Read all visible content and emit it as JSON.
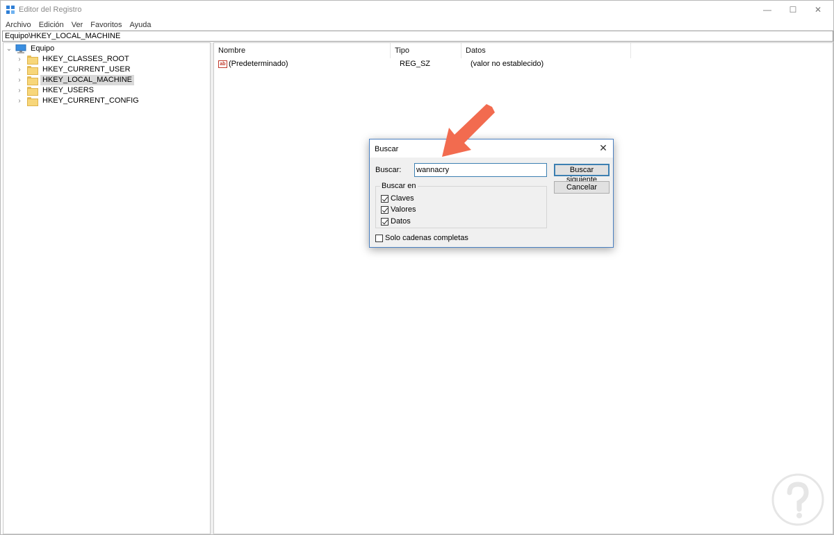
{
  "window": {
    "title": "Editor del Registro",
    "controls": {
      "minimize": "—",
      "maximize": "☐",
      "close": "✕"
    }
  },
  "menu": [
    "Archivo",
    "Edición",
    "Ver",
    "Favoritos",
    "Ayuda"
  ],
  "address": "Equipo\\HKEY_LOCAL_MACHINE",
  "tree": {
    "root": "Equipo",
    "items": [
      {
        "label": "HKEY_CLASSES_ROOT"
      },
      {
        "label": "HKEY_CURRENT_USER"
      },
      {
        "label": "HKEY_LOCAL_MACHINE"
      },
      {
        "label": "HKEY_USERS"
      },
      {
        "label": "HKEY_CURRENT_CONFIG"
      }
    ]
  },
  "list": {
    "columns": [
      "Nombre",
      "Tipo",
      "Datos"
    ],
    "rows": [
      {
        "name": "(Predeterminado)",
        "type": "REG_SZ",
        "data": "(valor no establecido)",
        "icon": "ab"
      }
    ]
  },
  "dialog": {
    "title": "Buscar",
    "find_label": "Buscar:",
    "find_value": "wannacry",
    "find_next": "Buscar siguiente",
    "cancel": "Cancelar",
    "group_label": "Buscar en",
    "options": [
      {
        "label": "Claves",
        "checked": true
      },
      {
        "label": "Valores",
        "checked": true
      },
      {
        "label": "Datos",
        "checked": true
      }
    ],
    "whole_string": {
      "label": "Solo cadenas completas",
      "checked": false
    }
  },
  "colors": {
    "arrow": "#f26b4f",
    "dialog_border": "#4a7fc0",
    "selection": "#d9d9d9"
  }
}
